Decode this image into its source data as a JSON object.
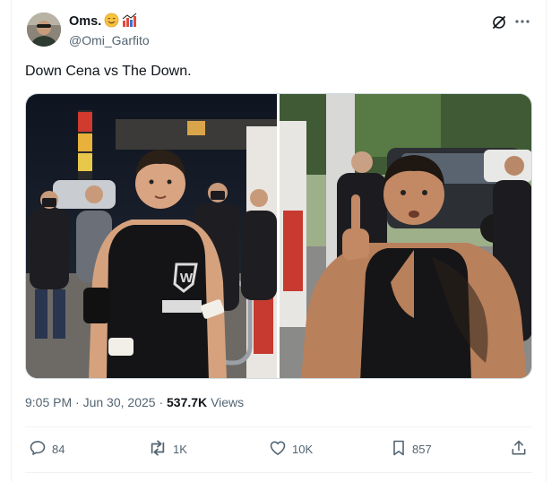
{
  "author": {
    "display_name": "Oms.",
    "handle": "@Omi_Garfito",
    "name_emojis": [
      "smiling-face-emoji",
      "factory-chart-emoji"
    ]
  },
  "tweet": {
    "text": "Down Cena vs The Down."
  },
  "media": {
    "images": [
      {
        "icon": "wrestler-gas-station-photo-left"
      },
      {
        "icon": "wrestler-gas-station-photo-right"
      }
    ]
  },
  "meta": {
    "time": "9:05 PM",
    "separator": " · ",
    "date": "Jun 30, 2025",
    "views_count": "537.7K",
    "views_label": "Views"
  },
  "actions": {
    "replies": "84",
    "reposts": "1K",
    "likes": "10K",
    "bookmarks": "857"
  },
  "colors": {
    "text_primary": "#0f1419",
    "text_secondary": "#536471",
    "border": "#eff3f4"
  }
}
